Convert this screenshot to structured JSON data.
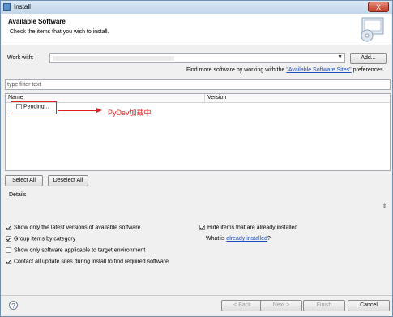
{
  "window": {
    "title": "Install",
    "close_label": "X"
  },
  "header": {
    "title": "Available Software",
    "subtitle": "Check the items that you wish to install."
  },
  "work_with": {
    "label": "Work with:",
    "add_label": "Add...",
    "hint_prefix": "Find more software by working with the ",
    "hint_link": "\"Available Software Sites\"",
    "hint_suffix": " preferences."
  },
  "filter": {
    "placeholder": "type filter text"
  },
  "table": {
    "columns": [
      "Name",
      "Version"
    ],
    "rows": [
      {
        "name": "Pending...",
        "checked": false
      }
    ]
  },
  "annotation": {
    "text": "PyDev加载中",
    "color": "#e02020"
  },
  "selection": {
    "select_all": "Select All",
    "deselect_all": "Deselect All"
  },
  "details": {
    "label": "Details"
  },
  "options": {
    "latest_versions": {
      "label": "Show only the latest versions of available software",
      "checked": true
    },
    "group_by_category": {
      "label": "Group items by category",
      "checked": true
    },
    "target_env": {
      "label": "Show only software applicable to target environment",
      "checked": false
    },
    "contact_sites": {
      "label": "Contact all update sites during install to find required software",
      "checked": true
    },
    "hide_installed": {
      "label": "Hide items that are already installed",
      "checked": true
    },
    "what_is_prefix": "What is ",
    "what_is_link": "already installed",
    "what_is_suffix": "?"
  },
  "footer": {
    "back": "< Back",
    "next": "Next >",
    "finish": "Finish",
    "cancel": "Cancel"
  }
}
